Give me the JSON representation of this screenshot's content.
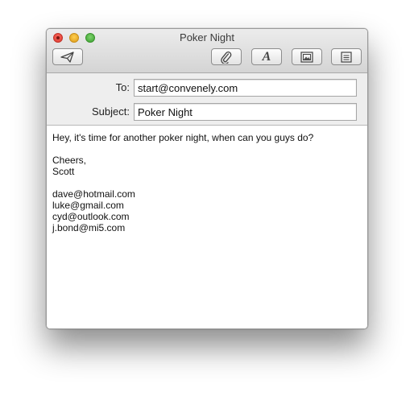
{
  "window": {
    "title": "Poker Night"
  },
  "toolbar": {
    "send": {
      "icon": "paper-plane-icon"
    },
    "attach": {
      "icon": "paperclip-icon"
    },
    "fonts": {
      "icon": "font-icon",
      "glyph": "A"
    },
    "photo": {
      "icon": "photo-browser-icon"
    },
    "stationery": {
      "icon": "stationery-icon"
    }
  },
  "header": {
    "to_label": "To:",
    "to_value": "start@convenely.com",
    "subject_label": "Subject:",
    "subject_value": "Poker Night"
  },
  "message": {
    "lines": [
      "Hey, it's time for another poker night, when can you guys do?",
      "",
      "Cheers,",
      "Scott",
      "",
      "dave@hotmail.com",
      "luke@gmail.com",
      "cyd@outlook.com",
      "j.bond@mi5.com"
    ]
  }
}
